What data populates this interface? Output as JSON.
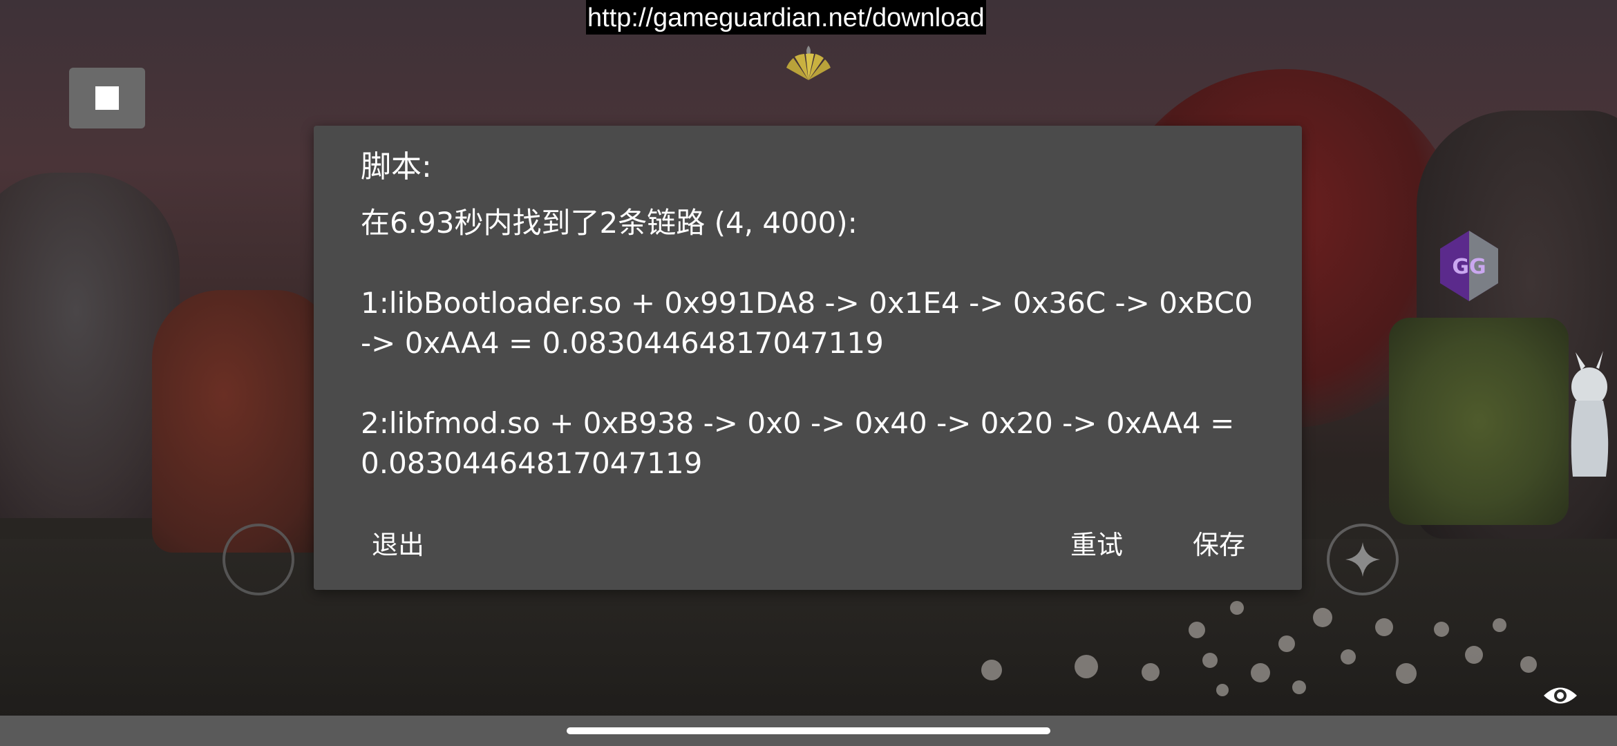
{
  "url_bar": {
    "text": "http://gameguardian.net/download"
  },
  "stop_button": {
    "icon": "stop-icon"
  },
  "overlay": {
    "fan_icon": "fan-icon",
    "gg_logo": "gameguardian-logo-icon",
    "sparkle_icon": "sparkle-icon",
    "eye_icon": "eye-icon",
    "gg_logo_text": "GG"
  },
  "dialog": {
    "title": "脚本:",
    "summary": "在6.93秒内找到了2条链路 (4, 4000):",
    "results": [
      "1:libBootloader.so + 0x991DA8 -> 0x1E4 -> 0x36C -> 0xBC0 -> 0xAA4 = 0.08304464817047119",
      "2:libfmod.so + 0xB938 -> 0x0 -> 0x40 -> 0x20 -> 0xAA4 = 0.08304464817047119"
    ],
    "buttons": {
      "exit": "退出",
      "retry": "重试",
      "save": "保存"
    }
  },
  "colors": {
    "dialog_bg": "#4b4b4b",
    "url_bar_bg": "#000000",
    "text": "#ffffff"
  }
}
